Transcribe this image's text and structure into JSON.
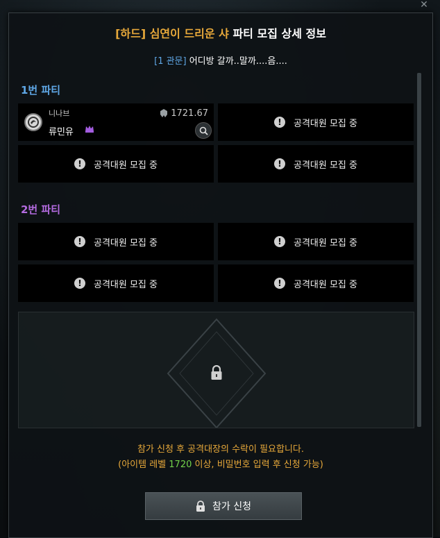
{
  "dialog": {
    "title_prefix": "[하드] 심연이 드리운 샤",
    "title_suffix": " 파티 모집 상세 정보",
    "stage_tag": "[1 관문]",
    "room_title": " 어디방 갈까..말까....음...."
  },
  "parties": [
    {
      "label": "1번 파티",
      "color": "#5fa7e6",
      "member": {
        "class_name": "니나브",
        "char_name": "류민유",
        "item_level": "1721.67",
        "is_leader": true
      },
      "empty_slot_text": "공격대원 모집 중"
    },
    {
      "label": "2번 파티",
      "color": "#b46be0",
      "empty_slot_text": "공격대원 모집 중"
    }
  ],
  "slots": {
    "p1s2": "공격대원 모집 중",
    "p1s3": "공격대원 모집 중",
    "p1s4": "공격대원 모집 중",
    "p2s1": "공격대원 모집 중",
    "p2s2": "공격대원 모집 중",
    "p2s3": "공격대원 모집 중",
    "p2s4": "공격대원 모집 중"
  },
  "notice": {
    "line1": "참가 신청 후 공격대장의 수락이 필요합니다.",
    "line2_prefix": "(아이템 레벨 ",
    "line2_level": "1720",
    "line2_suffix": " 이상, 비밀번호 입력 후 신청 가능)"
  },
  "apply_button": {
    "label": "참가 신청"
  },
  "icons": {
    "close": "close-icon",
    "warning": "exclamation-circle-icon",
    "crown": "crown-icon",
    "helmet": "helmet-icon",
    "inspect": "magnifier-icon",
    "lock": "lock-icon"
  },
  "colors": {
    "gold": "#e8a93a",
    "blue": "#5fa7e6",
    "purple": "#b46be0",
    "green": "#72d24a"
  }
}
